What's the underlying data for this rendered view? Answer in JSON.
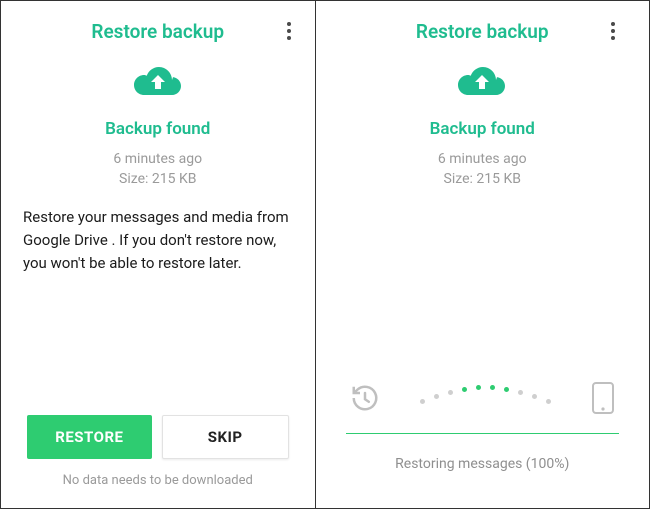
{
  "left": {
    "header": {
      "title": "Restore backup"
    },
    "found": "Backup found",
    "meta_time": "6 minutes ago",
    "meta_size": "Size: 215 KB",
    "description": "Restore your messages and media from Google Drive . If you don't restore now, you won't be able to restore later.",
    "buttons": {
      "restore": "RESTORE",
      "skip": "SKIP"
    },
    "footnote": "No data needs to be downloaded"
  },
  "right": {
    "header": {
      "title": "Restore backup"
    },
    "found": "Backup found",
    "meta_time": "6 minutes ago",
    "meta_size": "Size: 215 KB",
    "progress_text": "Restoring messages (100%)"
  },
  "colors": {
    "accent": "#1fbc8f",
    "primary_btn": "#2ecc71"
  }
}
